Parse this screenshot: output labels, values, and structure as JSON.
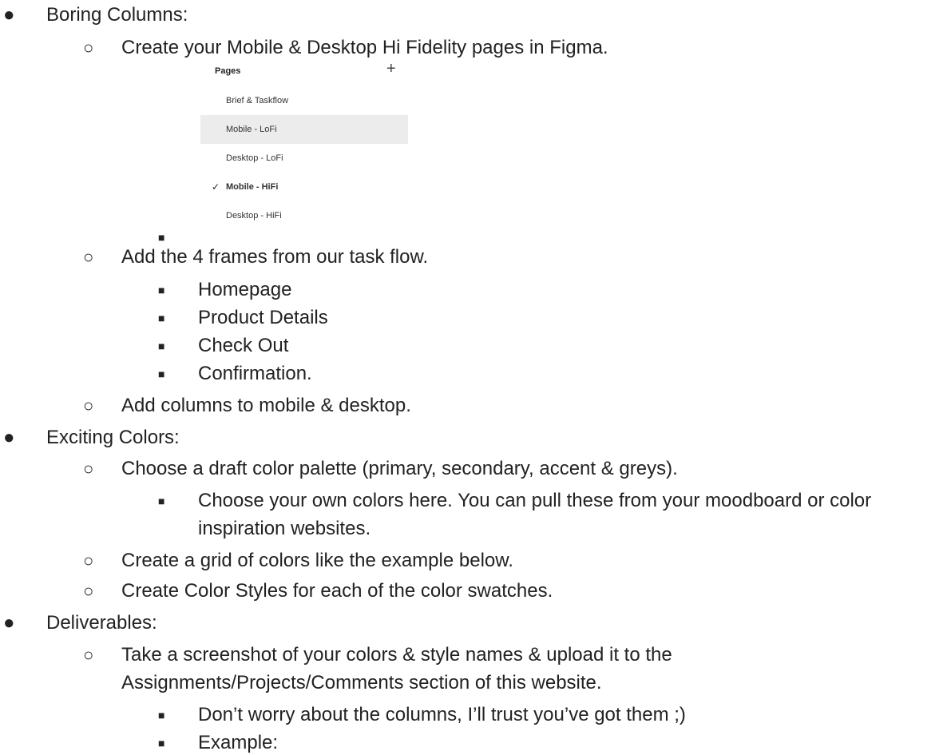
{
  "sections": [
    {
      "title": "Boring Columns:"
    },
    {
      "title": "Exciting Colors:"
    },
    {
      "title": "Deliverables:"
    }
  ],
  "boring": {
    "step1": "Create your Mobile & Desktop Hi Fidelity pages in Figma.",
    "step2": "Add the 4 frames from our task flow.",
    "frames": [
      "Homepage",
      "Product Details",
      "Check Out",
      "Confirmation."
    ],
    "step3": "Add columns to mobile & desktop."
  },
  "figma_pages": {
    "header": "Pages",
    "add_icon": "+",
    "check_icon": "✓",
    "items": [
      "Brief & Taskflow",
      "Mobile - LoFi",
      "Desktop - LoFi",
      "Mobile - HiFi",
      "Desktop - HiFi"
    ],
    "selected_item": "Mobile - LoFi",
    "current_item": "Mobile - HiFi",
    "selected_color": "#ececec"
  },
  "colors": {
    "step1": "Choose a draft color palette (primary, secondary, accent & greys).",
    "sub1_line1": "Choose your own colors here. You can pull these from your moodboard or color",
    "sub1_line2": "inspiration websites.",
    "step2": "Create a grid of colors like the example below.",
    "step3": "Create Color Styles for each of the color swatches."
  },
  "deliverables": {
    "step1_line1": "Take a screenshot of your colors & style names & upload it to the",
    "step1_line2": "Assignments/Projects/Comments section of this website.",
    "sub1": "Don’t worry about the columns, I’ll trust you’ve got them ;)",
    "sub2": "Example:"
  },
  "bullets": {
    "level1": "●",
    "level2": "○",
    "level3": "■"
  }
}
